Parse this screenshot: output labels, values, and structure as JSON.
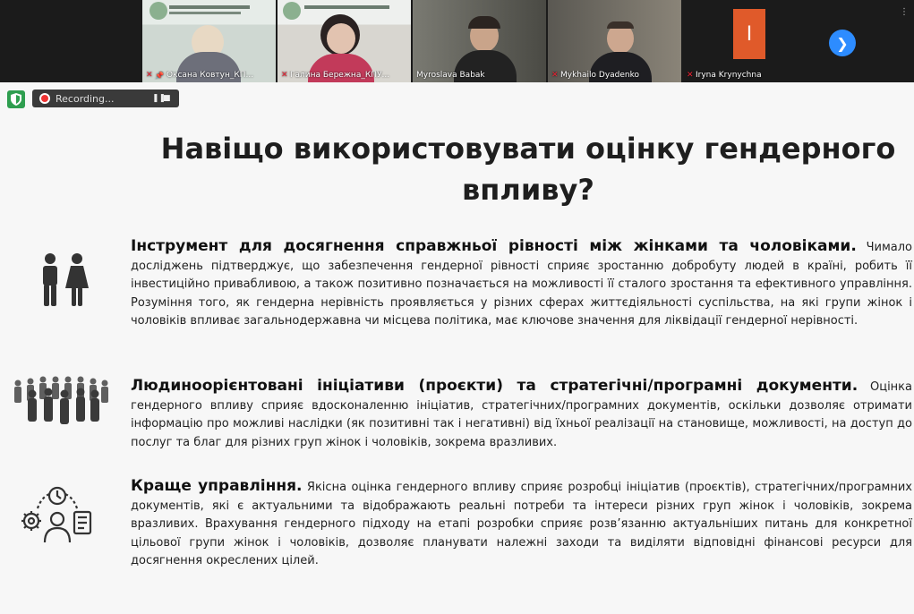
{
  "participants": [
    {
      "name": "Оксана Ковтун_КП...",
      "muted": true,
      "pinned": true
    },
    {
      "name": "Галина Бережна_КПУ...",
      "muted": true,
      "pinned": false
    },
    {
      "name": "Myroslava Babak",
      "muted": false,
      "pinned": false
    },
    {
      "name": "Mykhailo Dyadenko",
      "muted": true,
      "pinned": false
    },
    {
      "name": "Iryna Krynychna",
      "muted": true,
      "pinned": false
    }
  ],
  "recording": {
    "label": "Recording..."
  },
  "slide": {
    "title": "Навіщо використовувати оцінку гендерного впливу?",
    "sections": [
      {
        "icon": "man-woman-icon",
        "heading": "Інструмент для досягнення справжньої рівності між жінками та чоловіками.",
        "body": "Чимало досліджень підтверджує, що забезпечення гендерної рівності сприяє зростанню добробуту людей в країні, робить її інвестиційно привабливою, а також позитивно позначається на можливості її сталого зростання та ефективного управління. Розуміння того, як гендерна нерівність проявляється у різних сферах життєдіяльності суспільства, на які групи жінок і чоловіків впливає загальнодержавна чи місцева політика, має ключове значення для ліквідації гендерної нерівності."
      },
      {
        "icon": "crowd-icon",
        "heading": "Людиноорієнтовані ініціативи (проєкти) та стратегічні/програмні документи.",
        "body": "Оцінка гендерного впливу сприяє вдосконаленню ініціатив, стратегічних/програмних документів, оскільки дозволяє отримати інформацію про можливі наслідки (як позитивні так і негативні) від їхньої реалізації на становище, можливості, на доступ до послуг та благ для різних груп жінок і чоловіків, зокрема вразливих."
      },
      {
        "icon": "management-icon",
        "heading": "Краще управління.",
        "body": "Якісна оцінка гендерного впливу сприяє розробці ініціатив (проєктів), стратегічних/програмних документів, які є актуальними та відображають реальні потреби та інтереси різних груп жінок і чоловіків, зокрема вразливих. Врахування гендерного підходу на етапі розробки сприяє розв’язанню актуальніших питань для конкретної цільової групи жінок і чоловіків, дозволяє планувати належні заходи та виділяти відповідні фінансові ресурси для досягнення окреслених цілей."
      }
    ]
  }
}
